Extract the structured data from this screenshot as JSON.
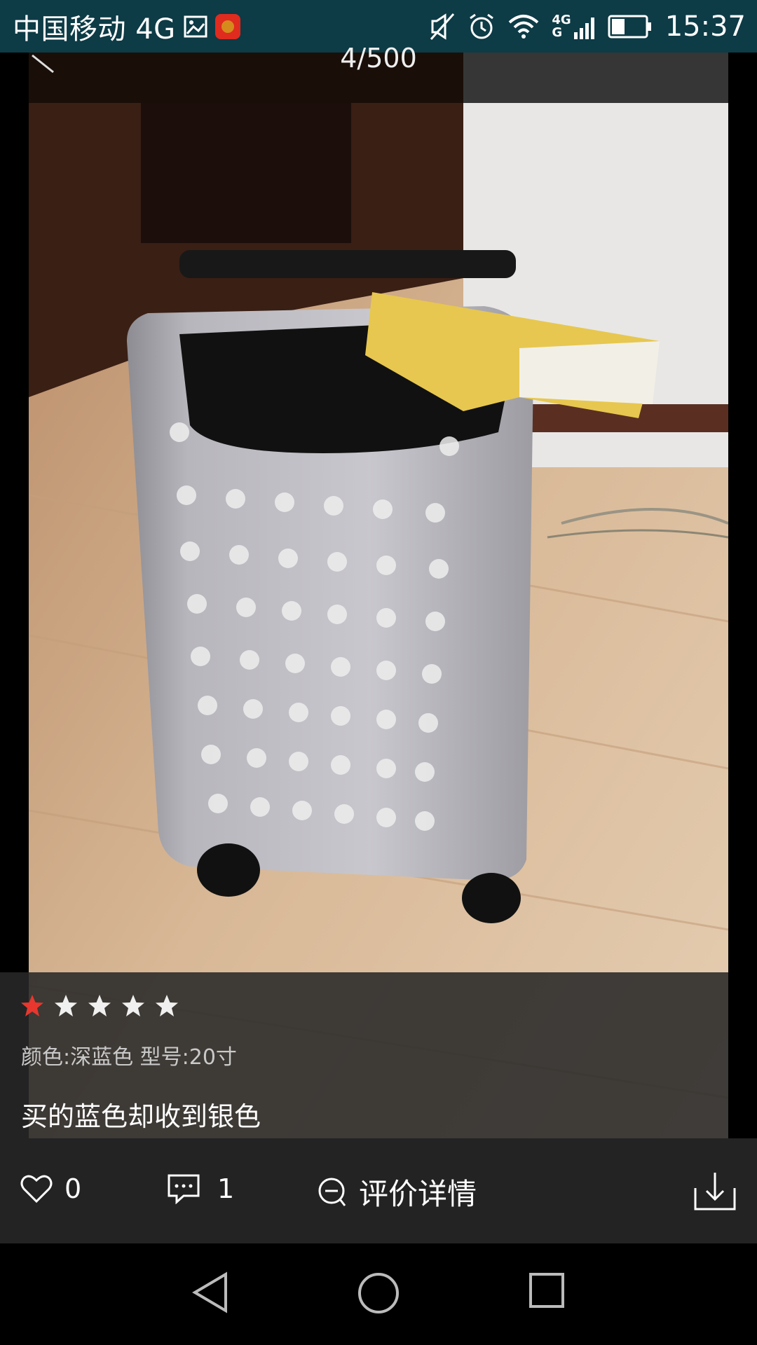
{
  "status_bar": {
    "carrier": "中国移动 4G",
    "network_tag_top": "4G",
    "network_tag_bottom": "G",
    "time": "15:37",
    "icons": [
      "image-icon",
      "app-badge-icon",
      "mute-icon",
      "alarm-icon",
      "wifi-icon",
      "signal-icon",
      "battery-icon"
    ]
  },
  "viewer": {
    "pager": "4/500",
    "back_icon": "back-arrow-icon",
    "photo_subject": "suitcase-photo"
  },
  "review": {
    "rating": 1,
    "max_rating": 5,
    "spec": "颜色:深蓝色 型号:20寸",
    "comment": "买的蓝色却收到银色",
    "star_colors": {
      "filled": "#e8372e",
      "empty": "#f0f0f0"
    }
  },
  "actions": {
    "likes": "0",
    "comments": "1",
    "details_label": "评价详情",
    "like_icon": "heart-icon",
    "comment_icon": "comment-icon",
    "details_icon": "details-icon",
    "download_icon": "download-icon"
  },
  "nav_bar": {
    "icons": [
      "back-triangle-icon",
      "home-circle-icon",
      "recents-square-icon"
    ]
  }
}
